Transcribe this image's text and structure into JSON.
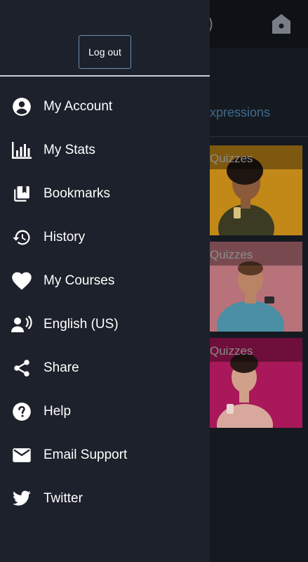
{
  "background": {
    "title_fragment": ")",
    "tab_label": "xpressions",
    "cards": [
      {
        "caption": "Quizzes",
        "color": "#e2a21d"
      },
      {
        "caption": "Quizzes",
        "color": "#d98a92"
      },
      {
        "caption": "Quizzes",
        "color": "#c41f6a"
      }
    ]
  },
  "drawer": {
    "logout_label": "Log out",
    "items": [
      {
        "label": "My Account",
        "icon": "account-circle-icon"
      },
      {
        "label": "My Stats",
        "icon": "bar-chart-icon"
      },
      {
        "label": "Bookmarks",
        "icon": "bookmarks-icon"
      },
      {
        "label": "History",
        "icon": "history-icon"
      },
      {
        "label": "My Courses",
        "icon": "heart-icon"
      },
      {
        "label": "English (US)",
        "icon": "voice-language-icon"
      },
      {
        "label": "Share",
        "icon": "share-icon"
      },
      {
        "label": "Help",
        "icon": "help-icon"
      },
      {
        "label": "Email Support",
        "icon": "mail-icon"
      },
      {
        "label": "Twitter",
        "icon": "twitter-icon"
      }
    ]
  }
}
